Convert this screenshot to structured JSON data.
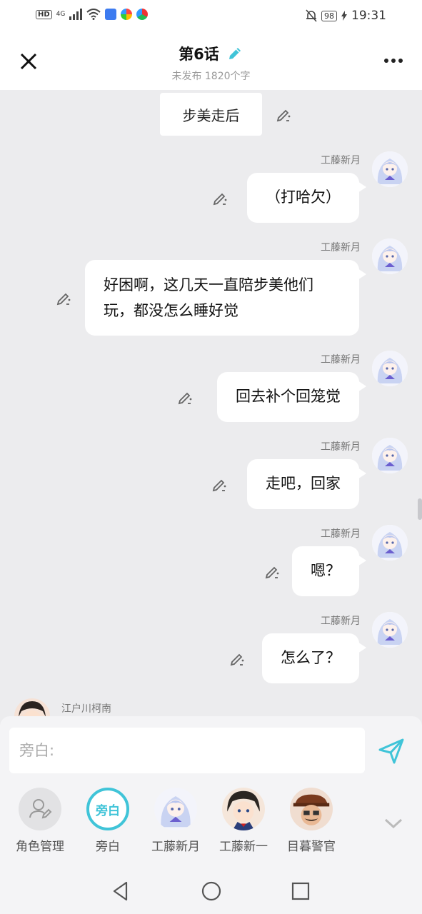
{
  "status_bar": {
    "hd": "HD",
    "network": "4G",
    "battery": "98",
    "time": "19:31"
  },
  "header": {
    "title": "第6话",
    "subtitle": "未发布 1820个字"
  },
  "chat": {
    "narration": "步美走后",
    "messages": [
      {
        "name": "工藤新月",
        "text": "（打哈欠）"
      },
      {
        "name": "工藤新月",
        "text": "好困啊，这几天一直陪步美他们玩，都没怎么睡好觉"
      },
      {
        "name": "工藤新月",
        "text": "回去补个回笼觉"
      },
      {
        "name": "工藤新月",
        "text": "走吧，回家"
      },
      {
        "name": "工藤新月",
        "text": "嗯？"
      },
      {
        "name": "工藤新月",
        "text": "怎么了？"
      }
    ],
    "next_sender": "江户川柯南"
  },
  "input": {
    "placeholder": "旁白:"
  },
  "roles": [
    {
      "label": "角色管理",
      "icon": "user-edit-icon"
    },
    {
      "label": "旁白",
      "badge": "旁白"
    },
    {
      "label": "工藤新月",
      "icon": "avatar"
    },
    {
      "label": "工藤新一",
      "icon": "avatar"
    },
    {
      "label": "目暮警官",
      "icon": "avatar"
    }
  ],
  "colors": {
    "accent": "#40c4d8",
    "chat_bg": "#ececee",
    "bubble": "#ffffff"
  }
}
